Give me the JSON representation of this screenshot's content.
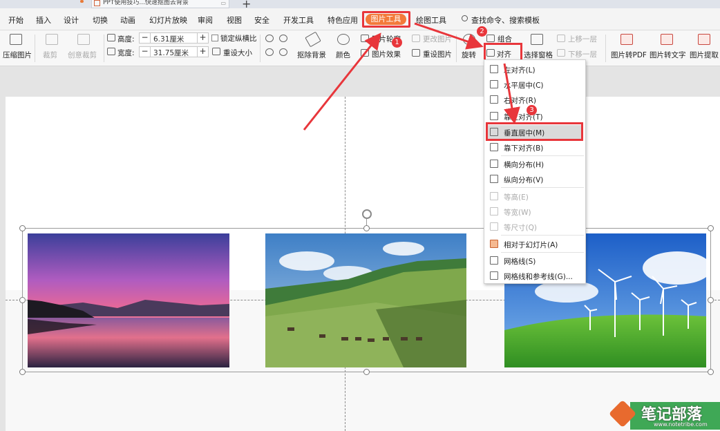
{
  "title_bar": {
    "doc_tab": "PPT使用技巧...快速抠图去背景",
    "new_tab_symbol": "+"
  },
  "menu": {
    "items": [
      "开始",
      "插入",
      "设计",
      "切换",
      "动画",
      "幻灯片放映",
      "审阅",
      "视图",
      "安全",
      "开发工具",
      "特色应用"
    ],
    "active_tab": "图片工具",
    "draw_tools": "绘图工具",
    "search": "查找命令、搜索模板"
  },
  "ribbon": {
    "compress": "压缩图片",
    "crop": "裁剪",
    "creative_crop": "创意裁剪",
    "height_label": "高度:",
    "height_value": "6.31厘米",
    "width_label": "宽度:",
    "width_value": "31.75厘米",
    "lock_ratio": "锁定纵横比",
    "reset_size": "重设大小",
    "remove_bg": "抠除背景",
    "color": "颜色",
    "pic_outline": "图片轮廓",
    "pic_effect": "图片效果",
    "change_pic": "更改图片",
    "reset_pic": "重设图片",
    "rotate": "旋转",
    "group": "组合",
    "align": "对齐",
    "select_pane": "选择窗格",
    "bring_forward": "上移一层",
    "send_backward": "下移一层",
    "pic_to_pdf": "图片转PDF",
    "pic_to_text": "图片转文字",
    "pic_extract": "图片提取"
  },
  "align_menu": {
    "items": [
      {
        "label": "左对齐(L)",
        "enabled": true
      },
      {
        "label": "水平居中(C)",
        "enabled": true
      },
      {
        "label": "右对齐(R)",
        "enabled": true
      },
      {
        "label": "靠上对齐(T)",
        "enabled": true
      },
      {
        "label": "垂直居中(M)",
        "enabled": true,
        "highlighted": true
      },
      {
        "label": "靠下对齐(B)",
        "enabled": true
      },
      {
        "label": "横向分布(H)",
        "enabled": true
      },
      {
        "label": "纵向分布(V)",
        "enabled": true
      },
      {
        "label": "等高(E)",
        "enabled": false
      },
      {
        "label": "等宽(W)",
        "enabled": false
      },
      {
        "label": "等尺寸(Q)",
        "enabled": false
      },
      {
        "label": "相对于幻灯片(A)",
        "enabled": true
      },
      {
        "label": "网格线(S)",
        "enabled": true
      },
      {
        "label": "网格线和参考线(G)...",
        "enabled": true
      }
    ]
  },
  "badges": [
    "1",
    "2",
    "3"
  ],
  "watermark": {
    "text": "笔记部落",
    "url": "www.notetribe.com"
  },
  "colors": {
    "accent": "#f37a3a",
    "annotation_red": "#e8363b"
  }
}
